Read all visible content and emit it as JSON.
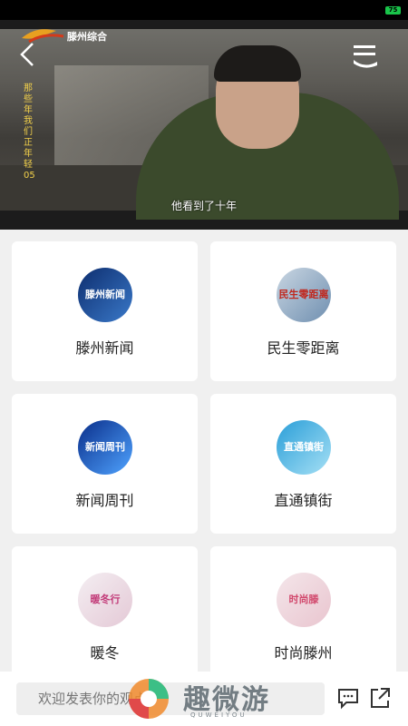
{
  "status_bar": {
    "battery": "75"
  },
  "video": {
    "channel": "滕州综合",
    "side_text": "那些年我们正年轻05",
    "subtitle": "他看到了十年"
  },
  "programs": [
    {
      "label": "滕州新闻",
      "logo_text": "滕州新闻",
      "logo_colors": [
        "#0d2d6e",
        "#3a79c9"
      ]
    },
    {
      "label": "民生零距离",
      "logo_text": "民生零距离",
      "logo_colors": [
        "#c9d6e2",
        "#6f8fb0"
      ]
    },
    {
      "label": "新闻周刊",
      "logo_text": "新闻周刊",
      "logo_colors": [
        "#0a2e8a",
        "#4fa3ff"
      ]
    },
    {
      "label": "直通镇街",
      "logo_text": "直通镇街",
      "logo_colors": [
        "#2a9ed8",
        "#a6e0f5"
      ]
    },
    {
      "label": "暖冬",
      "logo_text": "暖冬行",
      "logo_colors": [
        "#f4eef2",
        "#c23a78"
      ]
    },
    {
      "label": "时尚滕州",
      "logo_text": "时尚滕",
      "logo_colors": [
        "#f4e6ea",
        "#d24a6e"
      ]
    }
  ],
  "footer": {
    "comment_placeholder": "欢迎发表你的观点"
  },
  "watermark": {
    "text": "趣微游",
    "sub": "QUWEIYOU"
  }
}
